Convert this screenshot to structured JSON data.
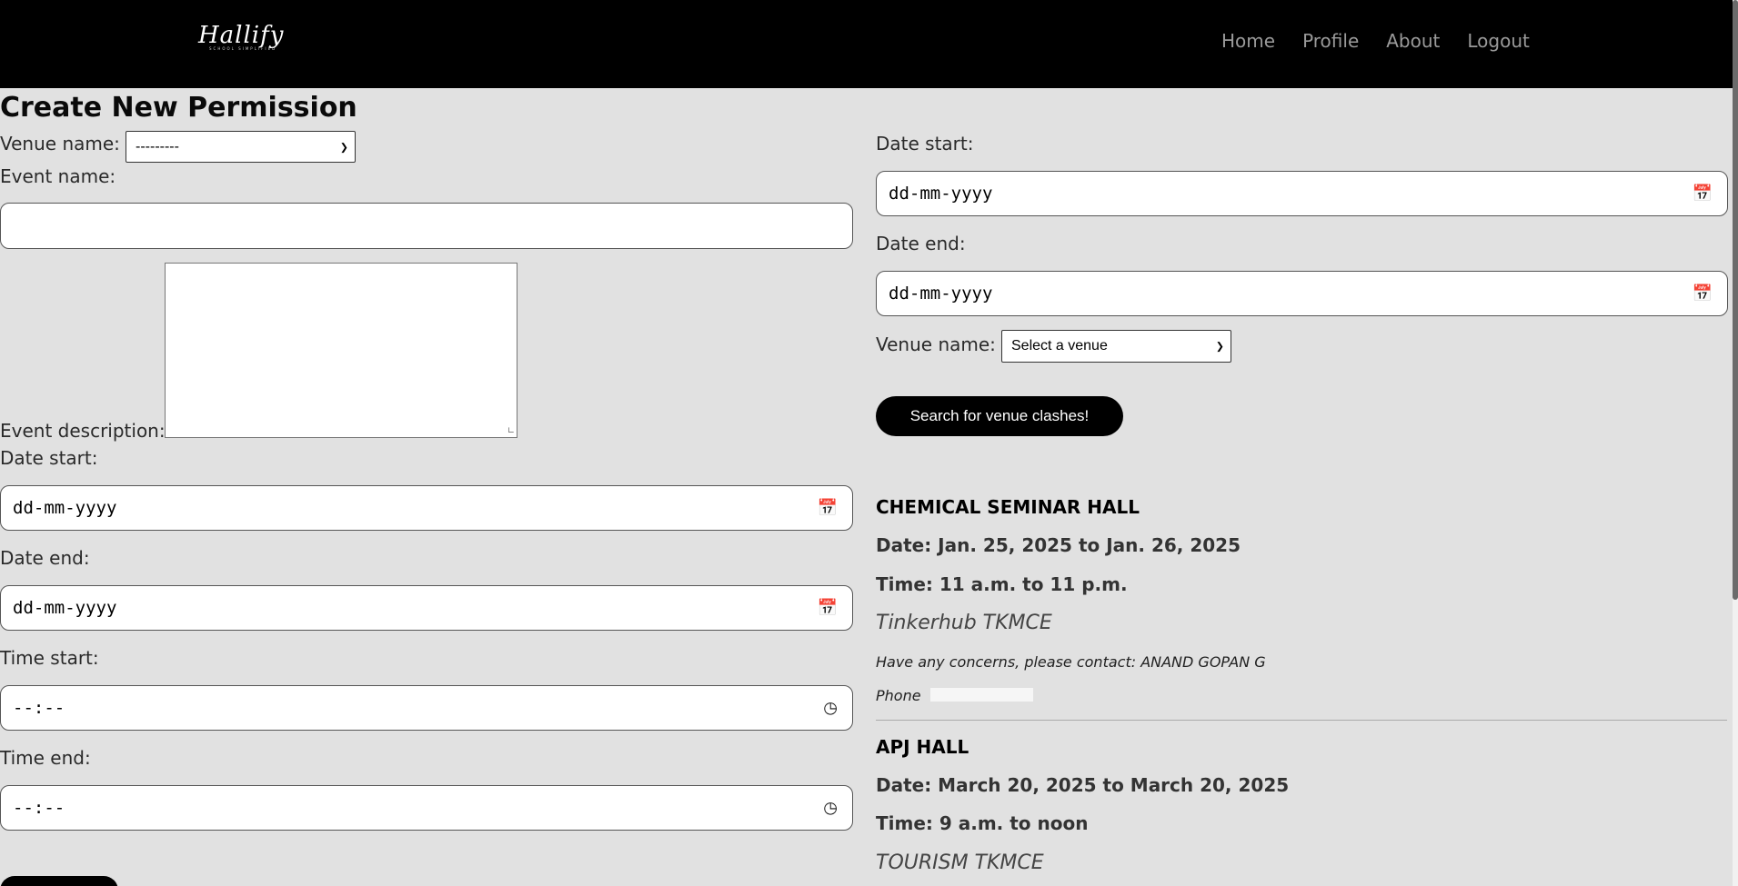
{
  "nav": {
    "logo": "Hallify",
    "logo_tagline": "SCHOOL SIMPLIFIED",
    "links": [
      "Home",
      "Profile",
      "About",
      "Logout"
    ]
  },
  "form": {
    "title": "Create New Permission",
    "venue_label": "Venue name:",
    "venue_value": "---------",
    "event_name_label": "Event name:",
    "event_name_value": "",
    "event_desc_label": "Event description:",
    "date_start_label": "Date start:",
    "date_start_placeholder": "dd-mm-yyyy",
    "date_end_label": "Date end:",
    "date_end_placeholder": "dd-mm-yyyy",
    "time_start_label": "Time start:",
    "time_start_placeholder": "--:--",
    "time_end_label": "Time end:",
    "time_end_placeholder": "--:--"
  },
  "search": {
    "date_start_label": "Date start:",
    "date_start_placeholder": "dd-mm-yyyy",
    "date_end_label": "Date end:",
    "date_end_placeholder": "dd-mm-yyyy",
    "venue_label": "Venue name:",
    "venue_value": "Select a venue",
    "button_label": "Search for venue clashes!"
  },
  "clashes": [
    {
      "venue": "CHEMICAL SEMINAR HALL",
      "date": "Date: Jan. 25, 2025 to Jan. 26, 2025",
      "time": "Time: 11 a.m. to 11 p.m.",
      "org": "Tinkerhub TKMCE",
      "contact": "Have any concerns, please contact: ANAND GOPAN G",
      "phone": "Phone"
    },
    {
      "venue": "APJ HALL",
      "date": "Date: March 20, 2025 to March 20, 2025",
      "time": "Time: 9 a.m. to noon",
      "org": "TOURISM TKMCE"
    }
  ],
  "icons": {
    "calendar": "calendar-icon",
    "clock": "clock-icon"
  }
}
